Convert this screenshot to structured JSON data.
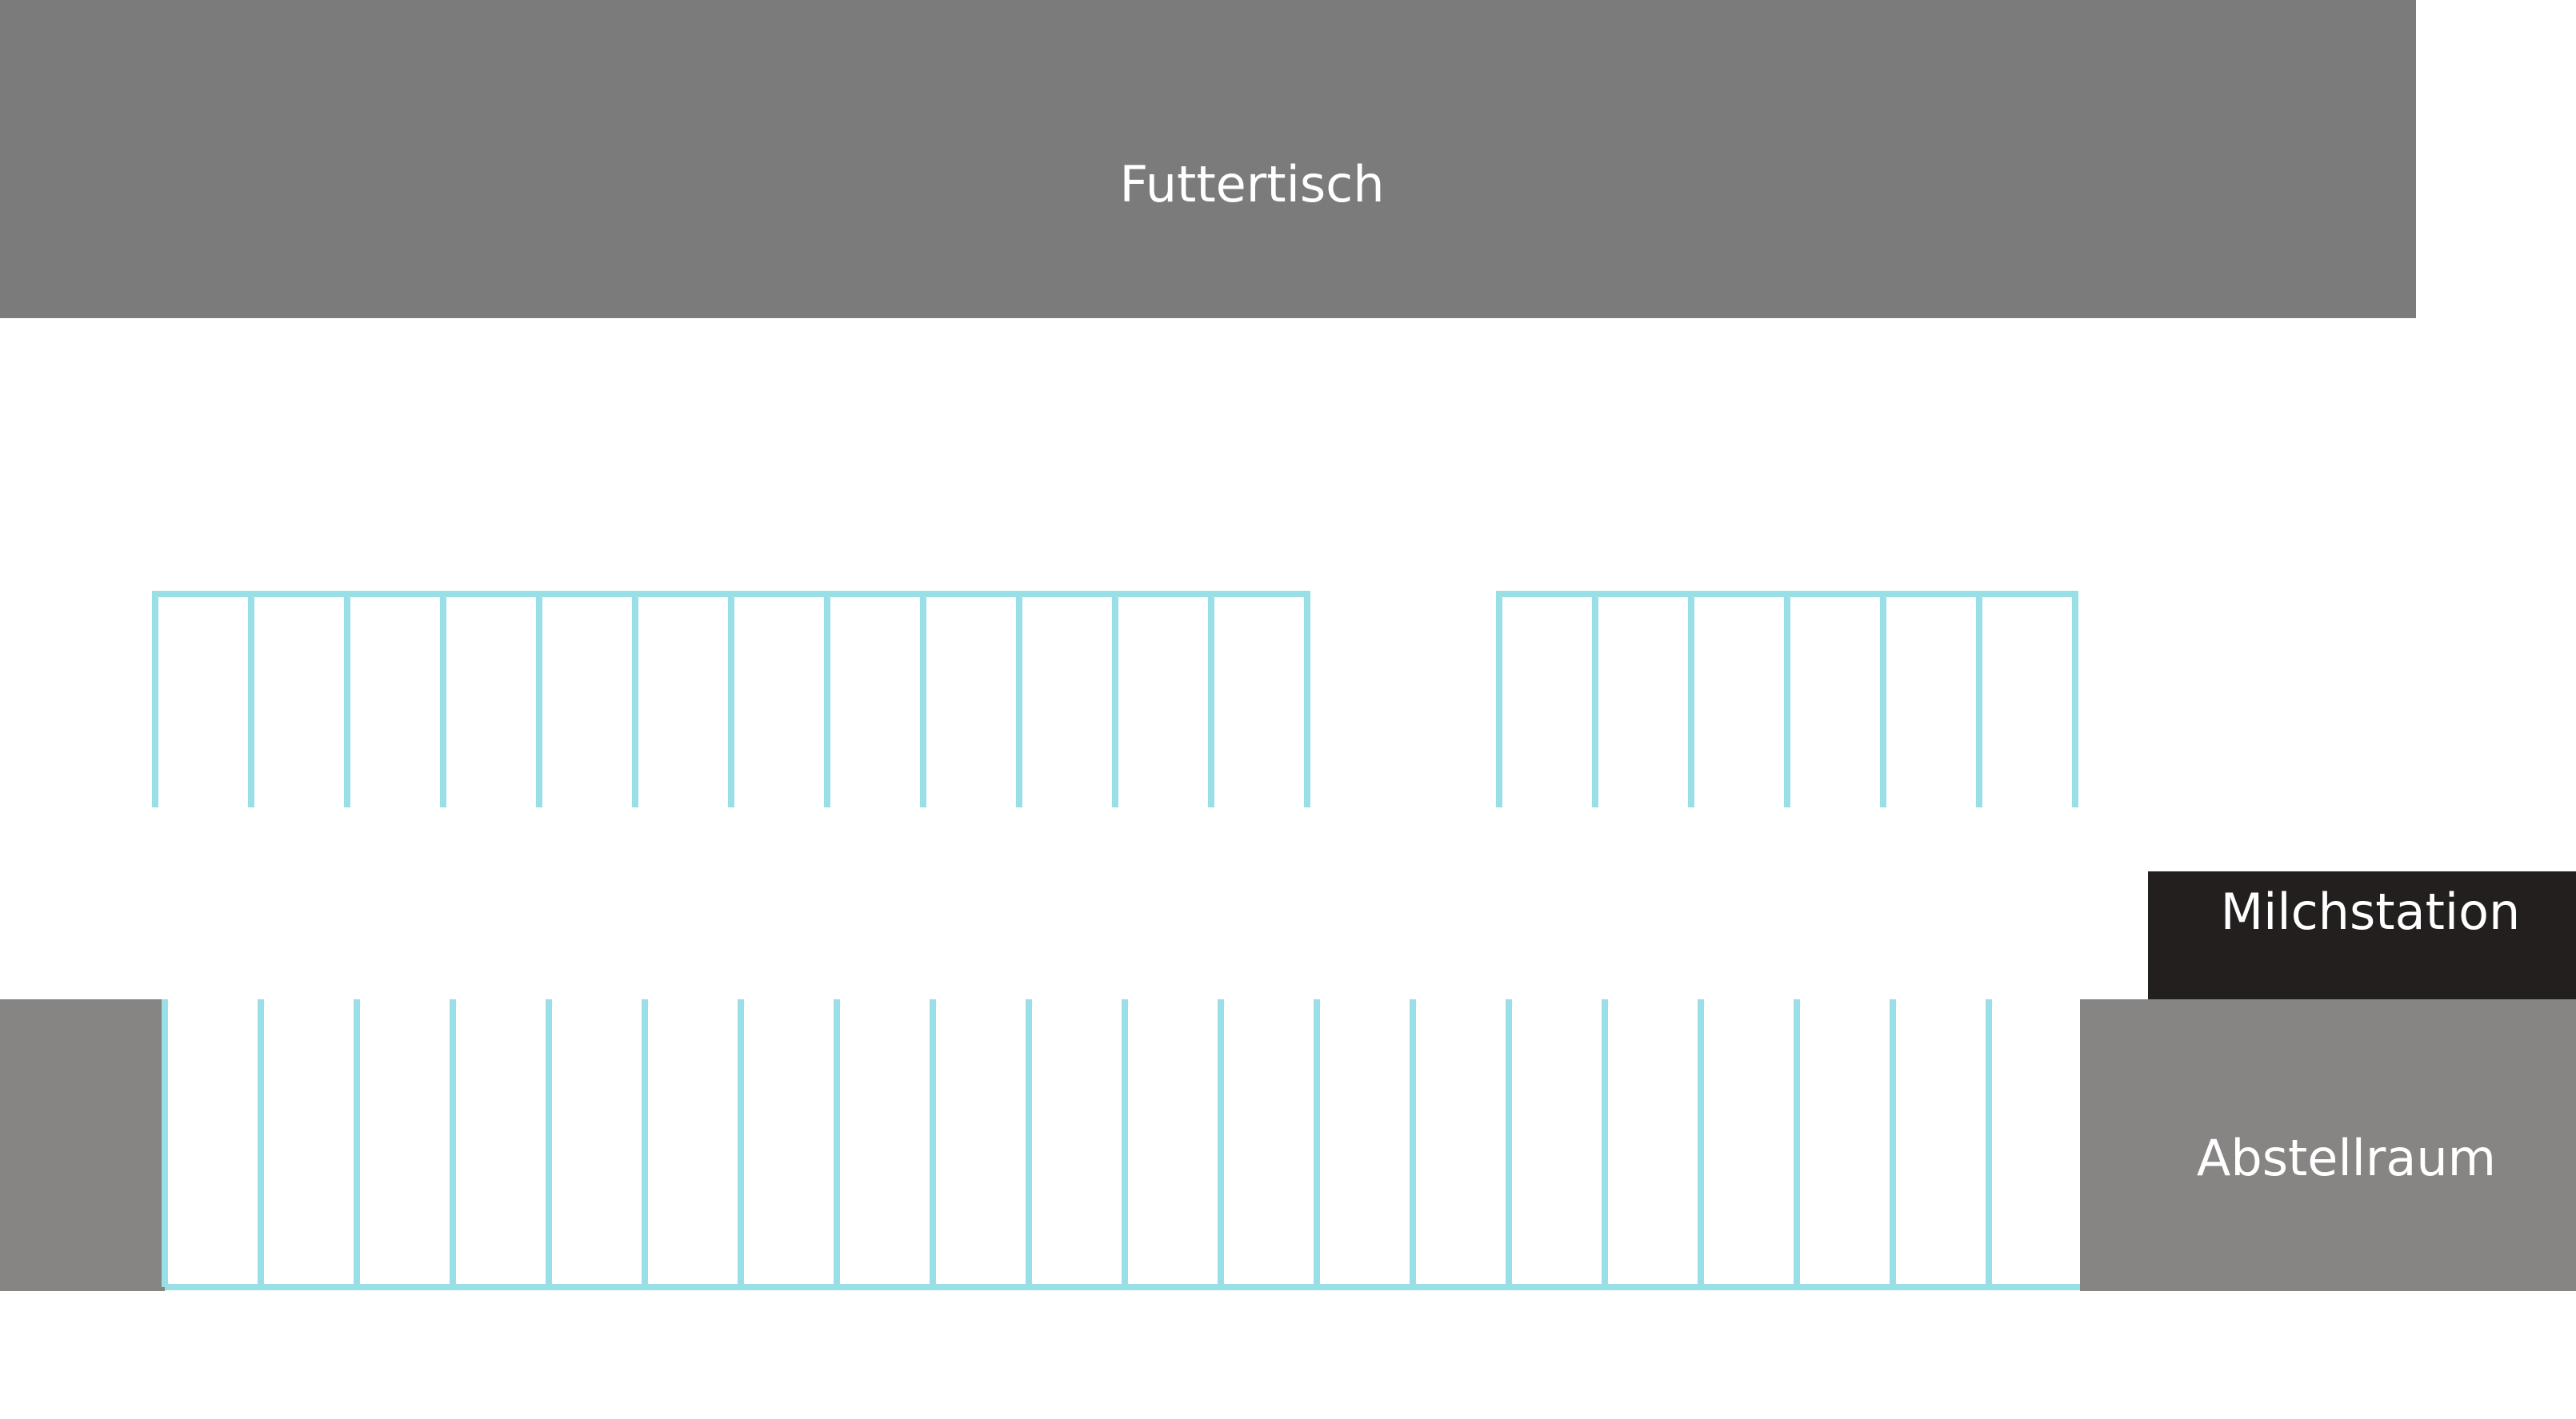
{
  "rooms": {
    "feed_table": {
      "label": "Futtertisch",
      "color": "#7b7b7b"
    },
    "milk_station": {
      "label": "Milchstation",
      "color": "#231f1f"
    },
    "storage": {
      "label": "Abstellraum",
      "color": "#878484"
    },
    "left_wall": {
      "color": "#878484"
    }
  },
  "stalls": {
    "color": "#99e0e6",
    "upper_left_group_count": 12,
    "upper_right_group_count": 6,
    "lower_row_count": 20
  }
}
